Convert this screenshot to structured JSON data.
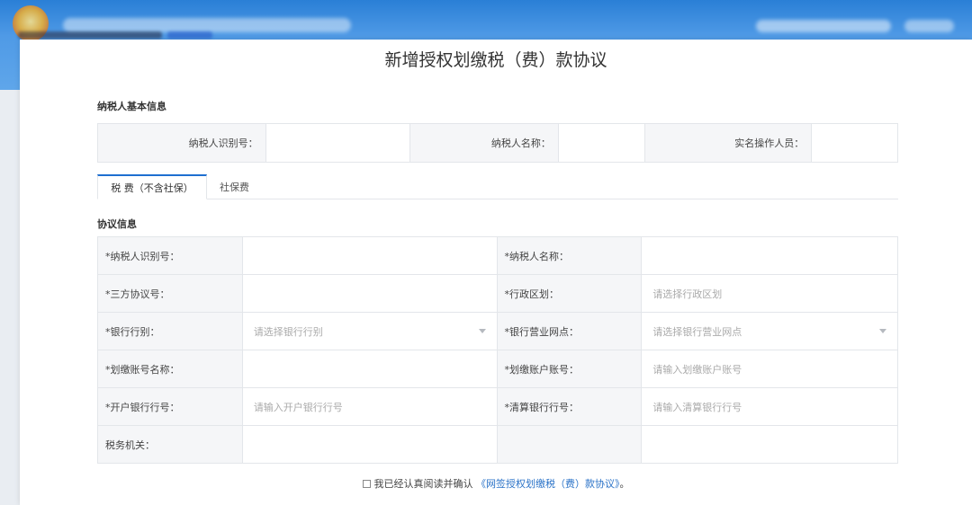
{
  "page": {
    "title": "新增授权划缴税（费）款协议"
  },
  "basic_info": {
    "section_title": "纳税人基本信息",
    "fields": [
      {
        "label": "纳税人识别号：",
        "value": ""
      },
      {
        "label": "纳税人名称：",
        "value": ""
      },
      {
        "label": "实名操作人员：",
        "value": ""
      }
    ]
  },
  "tabs": [
    {
      "label": "税 费（不含社保）",
      "active": true
    },
    {
      "label": "社保费",
      "active": false
    }
  ],
  "agreement": {
    "section_title": "协议信息",
    "rows": [
      {
        "l1": "*纳税人识别号：",
        "v1": "",
        "l2": "*纳税人名称：",
        "v2": ""
      },
      {
        "l1": "*三方协议号：",
        "v1": "",
        "l2": "*行政区划：",
        "v2": "请选择行政区划"
      },
      {
        "l1": "*银行行别：",
        "v1": "请选择银行行别",
        "l2": "*银行营业网点：",
        "v2": "请选择银行营业网点"
      },
      {
        "l1": "*划缴账号名称：",
        "v1": "",
        "l2": "*划缴账户账号：",
        "v2": "请输入划缴账户账号"
      },
      {
        "l1": "*开户银行行号：",
        "v1": "请输入开户银行行号",
        "l2": "*清算银行行号：",
        "v2": "请输入清算银行行号"
      },
      {
        "l1": "税务机关：",
        "v1": "",
        "l2": "",
        "v2": ""
      }
    ]
  },
  "confirm": {
    "prefix": "我已经认真阅读并确认",
    "link": "《网签授权划缴税（费）款协议》",
    "suffix": "。"
  }
}
